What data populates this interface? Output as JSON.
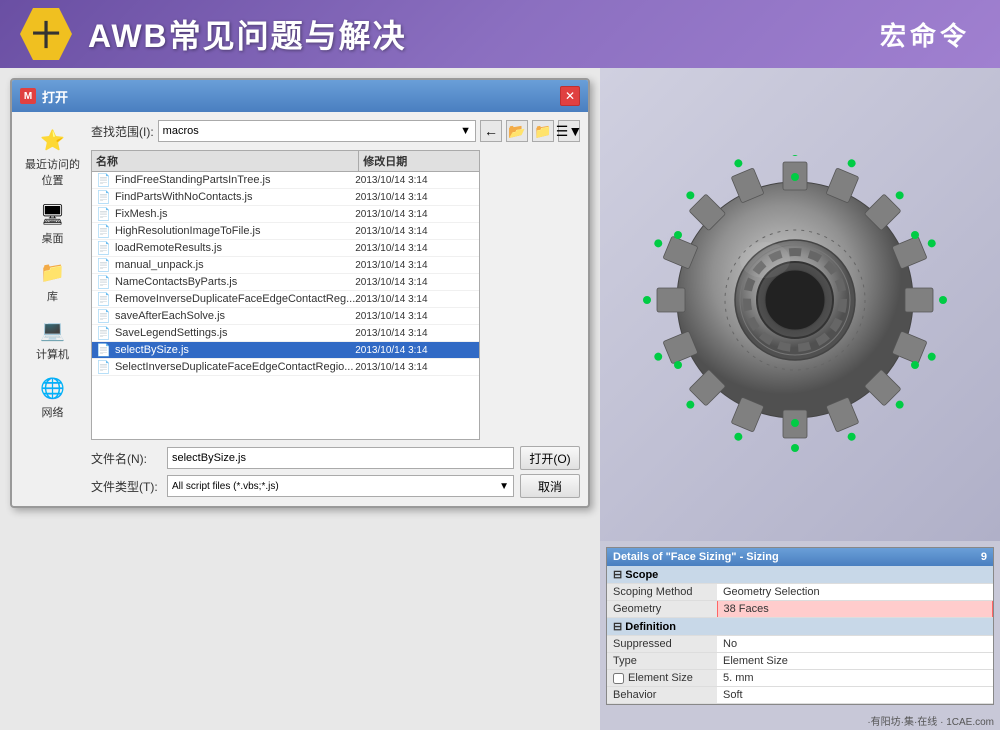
{
  "header": {
    "hex_symbol": "十",
    "title": "AWB常见问题与解决",
    "subtitle": "宏命令"
  },
  "dialog": {
    "title": "打开",
    "title_icon": "M",
    "toolbar_label": "查找范围(I):",
    "toolbar_folder": "macros",
    "file_list_col_name": "名称",
    "file_list_col_date": "修改日期",
    "files": [
      {
        "name": "FindFreeStandingPartsInTree.js",
        "date": "2013/10/14 3:14",
        "icon": "📄"
      },
      {
        "name": "FindPartsWithNoContacts.js",
        "date": "2013/10/14 3:14",
        "icon": "📄"
      },
      {
        "name": "FixMesh.js",
        "date": "2013/10/14 3:14",
        "icon": "📄"
      },
      {
        "name": "HighResolutionImageToFile.js",
        "date": "2013/10/14 3:14",
        "icon": "📄"
      },
      {
        "name": "loadRemoteResults.js",
        "date": "2013/10/14 3:14",
        "icon": "📄"
      },
      {
        "name": "manual_unpack.js",
        "date": "2013/10/14 3:14",
        "icon": "📄"
      },
      {
        "name": "NameContactsByParts.js",
        "date": "2013/10/14 3:14",
        "icon": "📄"
      },
      {
        "name": "RemoveInverseDuplicateFaceEdgeContactReg...",
        "date": "2013/10/14 3:14",
        "icon": "📄"
      },
      {
        "name": "saveAfterEachSolve.js",
        "date": "2013/10/14 3:14",
        "icon": "📄"
      },
      {
        "name": "SaveLegendSettings.js",
        "date": "2013/10/14 3:14",
        "icon": "📄"
      },
      {
        "name": "selectBySize.js",
        "date": "2013/10/14 3:14",
        "icon": "📄",
        "selected": true
      },
      {
        "name": "SelectInverseDuplicateFaceEdgeContactRegio...",
        "date": "2013/10/14 3:14",
        "icon": "📄"
      }
    ],
    "filename_label": "文件名(N):",
    "filename_value": "selectBySize.js",
    "filetype_label": "文件类型(T):",
    "filetype_value": "All script files (*.vbs;*.js)",
    "open_btn": "打开(O)",
    "cancel_btn": "取消"
  },
  "sidebar_items": [
    {
      "label": "最近访问的位置",
      "icon": "⭐"
    },
    {
      "label": "桌面",
      "icon": "🖥"
    },
    {
      "label": "库",
      "icon": "📁"
    },
    {
      "label": "计算机",
      "icon": "💻"
    },
    {
      "label": "网络",
      "icon": "🌐"
    }
  ],
  "details": {
    "title": "Details of \"Face Sizing\" - Sizing",
    "title_num": "9",
    "scope_header": "Scope",
    "scoping_method_label": "Scoping Method",
    "scoping_method_value": "Geometry Selection",
    "geometry_label": "Geometry",
    "geometry_value": "38 Faces",
    "definition_header": "Definition",
    "suppressed_label": "Suppressed",
    "suppressed_value": "No",
    "type_label": "Type",
    "type_value": "Element Size",
    "element_size_label": "Element Size",
    "element_size_value": "5. mm",
    "behavior_label": "Behavior",
    "behavior_value": "Soft"
  },
  "watermark": "有阳坊·集·在线",
  "watermark_site": "1CAE.com"
}
